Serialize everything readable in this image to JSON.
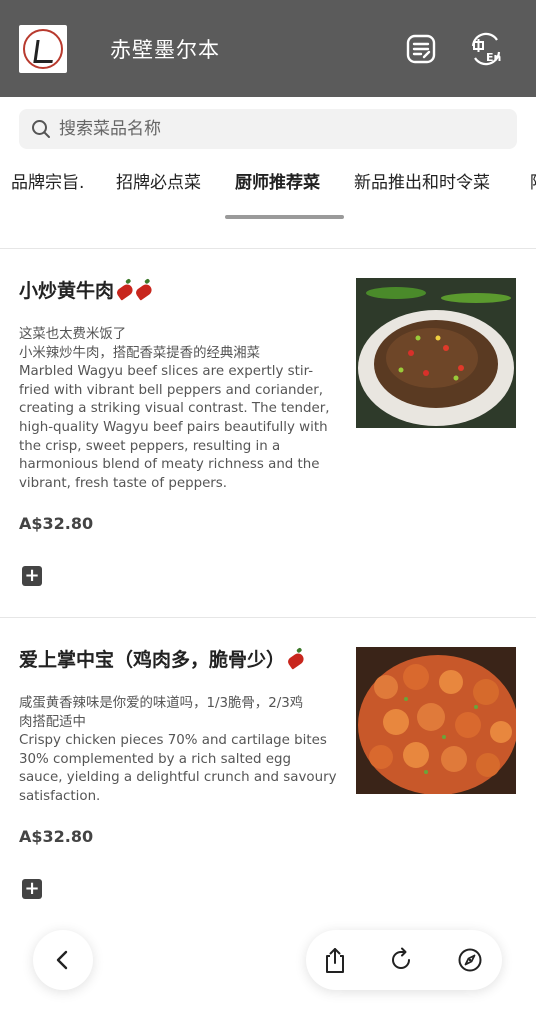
{
  "header": {
    "title": "赤壁墨尔本",
    "logo_icon": "restaurant-logo",
    "order_icon": "order-list-icon",
    "lang_icon": "language-switch-icon",
    "bg_color": "#5b5b5b"
  },
  "search": {
    "placeholder": "搜索菜品名称",
    "value": ""
  },
  "tabs": [
    {
      "label": "品牌宗旨."
    },
    {
      "label": "招牌必点菜"
    },
    {
      "label": "厨师推荐菜",
      "active": true
    },
    {
      "label": "新品推出和时令菜"
    },
    {
      "label": "陆"
    }
  ],
  "dishes": [
    {
      "name": "小炒黄牛肉",
      "chili_count": 2,
      "desc_lines": [
        "这菜也太费米饭了",
        "小米辣炒牛肉，搭配香菜提香的经典湘菜",
        "Marbled Wagyu beef slices are expertly stir-",
        "fried with vibrant bell peppers and coriander,",
        "creating a striking visual contrast. The tender,",
        "high-quality Wagyu beef pairs beautifully with",
        "the crisp, sweet peppers, resulting in a",
        "harmonious blend of meaty richness and the",
        "vibrant, fresh taste of peppers."
      ],
      "price": "A$32.80",
      "add_label": "+"
    },
    {
      "name": "爱上掌中宝（鸡肉多，脆骨少）",
      "chili_count": 1,
      "desc_lines": [
        "咸蛋黄香辣味是你爱的味道吗，1/3脆骨，2/3鸡",
        "肉搭配适中",
        "Crispy chicken pieces 70% and cartilage bites",
        "30% complemented by a rich salted egg",
        "sauce, yielding a delightful crunch and savoury",
        "satisfaction."
      ],
      "price": "A$32.80",
      "add_label": "+"
    }
  ],
  "browser_bar": {
    "back_icon": "back-chevron-icon",
    "share_icon": "share-icon",
    "reload_icon": "reload-icon",
    "browser_icon": "compass-icon"
  }
}
